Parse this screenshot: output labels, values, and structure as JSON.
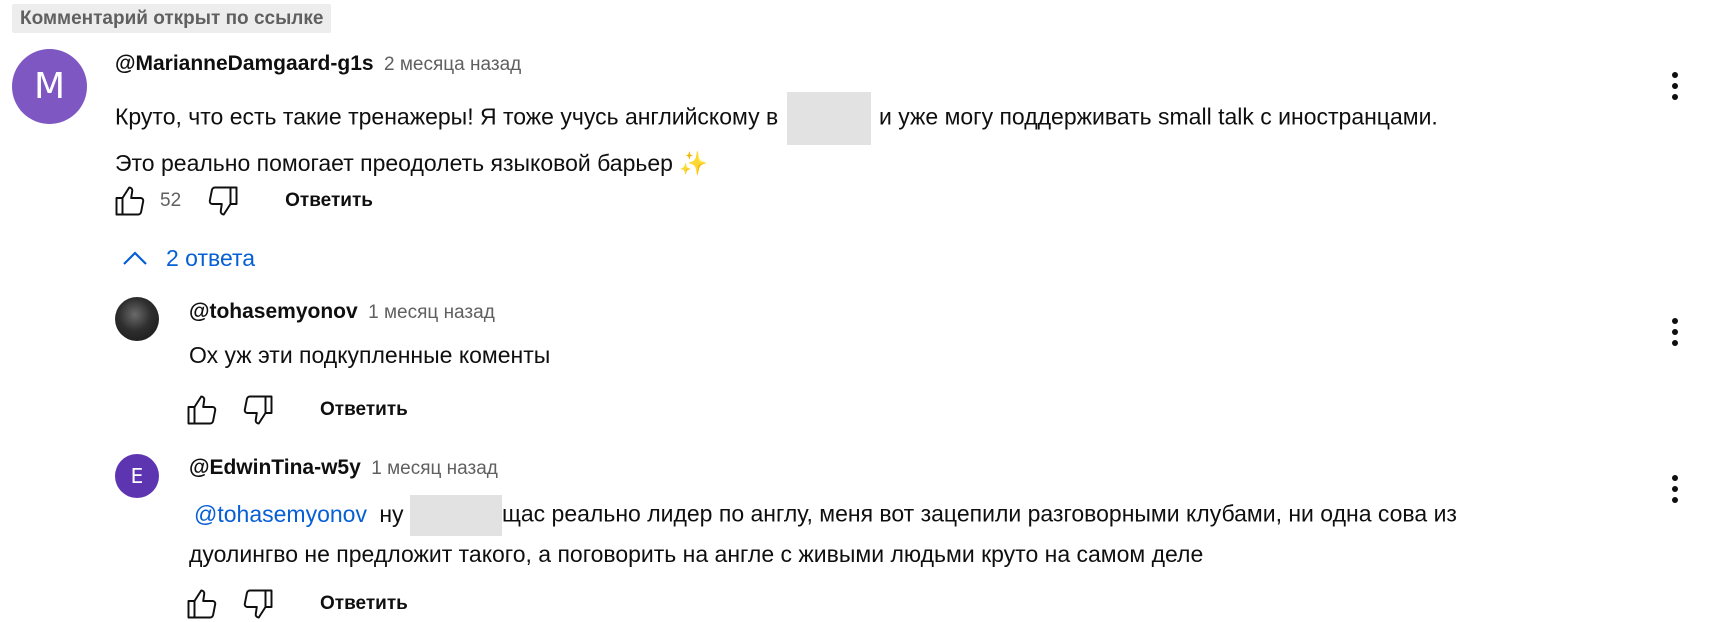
{
  "badge": "Комментарий открыт по ссылке",
  "comment": {
    "avatar_letter": "M",
    "author": "@MarianneDamgaard-g1s",
    "time": "2 месяца назад",
    "text_line1_before": "Круто, что есть такие тренажеры! Я тоже учусь английскому в",
    "text_line1_after": "и уже могу поддерживать small talk с иностранцами.",
    "text_line2": "Это реально помогает преодолеть языковой барьер ✨",
    "like_count": "52",
    "reply_label": "Ответить"
  },
  "replies_toggle": {
    "label": "2 ответа"
  },
  "replies": [
    {
      "author": "@tohasemyonov",
      "time": "1 месяц назад",
      "text": "Ох уж эти подкупленные коменты",
      "reply_label": "Ответить"
    },
    {
      "avatar_letter": "E",
      "author": "@EdwinTina-w5y",
      "time": "1 месяц назад",
      "mention": "@tohasemyonov",
      "text_line1_before": "ну",
      "text_line1_after": "щас реально лидер по англу, меня вот зацепили разговорными клубами, ни одна сова из",
      "text_line2": "дуолингво не предложит такого, а поговорить на англе с живыми людьми круто на самом деле",
      "reply_label": "Ответить"
    }
  ],
  "icons": {
    "like": "thumbs-up-icon",
    "dislike": "thumbs-down-icon",
    "menu": "more-vert-icon",
    "collapse": "chevron-up-icon"
  },
  "colors": {
    "link": "#065fd4",
    "avatar_m": "#7e57c2",
    "avatar_e": "#5e35b1"
  }
}
